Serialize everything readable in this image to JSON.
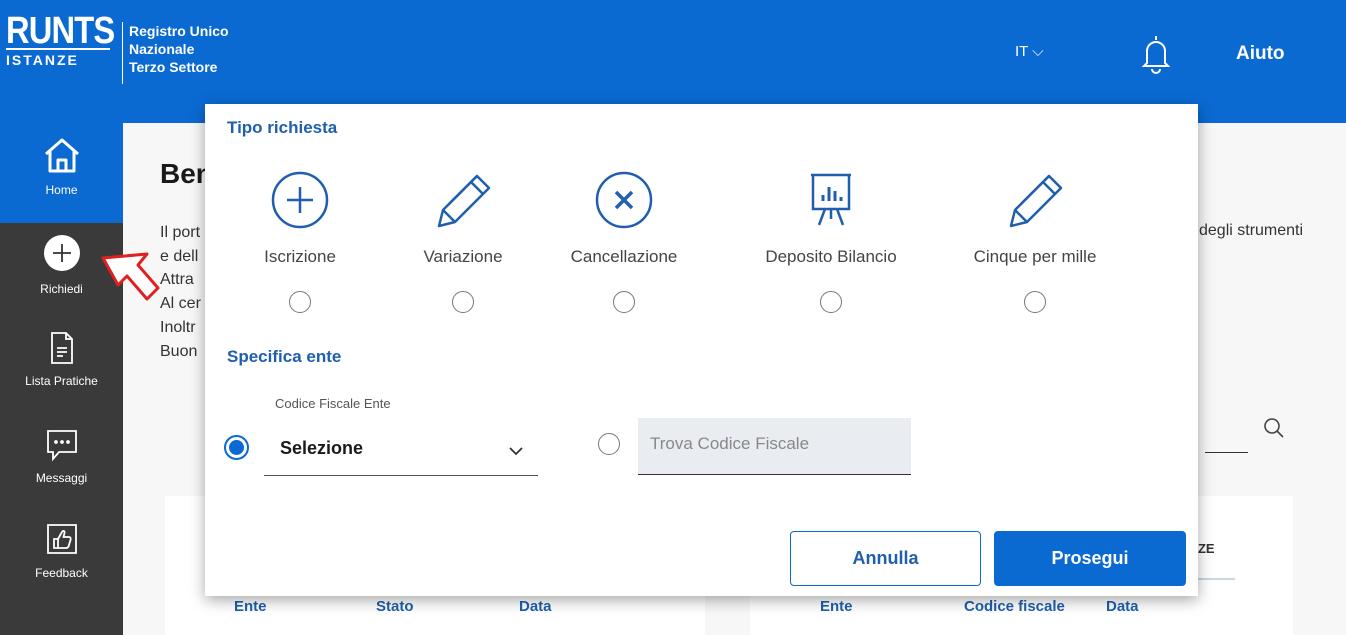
{
  "header": {
    "logo_top": "RUNTS",
    "logo_bottom": "ISTANZE",
    "registro_line1": "Registro Unico",
    "registro_line2": "Nazionale",
    "registro_line3": "Terzo Settore",
    "language": "IT ⌵",
    "help_label": "Aiuto"
  },
  "sidebar": {
    "items": [
      {
        "label": "Home",
        "icon": "home-icon"
      },
      {
        "label": "Richiedi",
        "icon": "plus-icon"
      },
      {
        "label": "Lista Pratiche",
        "icon": "document-icon"
      },
      {
        "label": "Messaggi",
        "icon": "chat-icon"
      },
      {
        "label": "Feedback",
        "icon": "thumbs-up-icon"
      }
    ]
  },
  "background": {
    "title": "Ben",
    "lines": [
      "Il port",
      "e dell",
      "Attra",
      "Al cer",
      "Inoltr",
      "Buon"
    ],
    "right_text": "degli strumenti",
    "tab_partial": "ZZE",
    "table_left_headers": [
      "Ente",
      "Stato",
      "Data"
    ],
    "table_right_headers": [
      "Ente",
      "Codice fiscale",
      "Data"
    ]
  },
  "modal": {
    "tipo_title": "Tipo richiesta",
    "options": [
      {
        "label": "Iscrizione",
        "icon": "plus-circle-icon"
      },
      {
        "label": "Variazione",
        "icon": "pencil-icon"
      },
      {
        "label": "Cancellazione",
        "icon": "x-circle-icon"
      },
      {
        "label": "Deposito Bilancio",
        "icon": "chart-board-icon"
      },
      {
        "label": "Cinque per mille",
        "icon": "pencil-icon"
      }
    ],
    "specifica_title": "Specifica ente",
    "cf_label": "Codice Fiscale Ente",
    "select_value": "Selezione",
    "find_placeholder": "Trova Codice Fiscale",
    "cancel_label": "Annulla",
    "proceed_label": "Prosegui"
  },
  "colors": {
    "primary": "#0a6ad2",
    "sidebar": "#3a3a3a",
    "heading_blue": "#1f5fae"
  }
}
